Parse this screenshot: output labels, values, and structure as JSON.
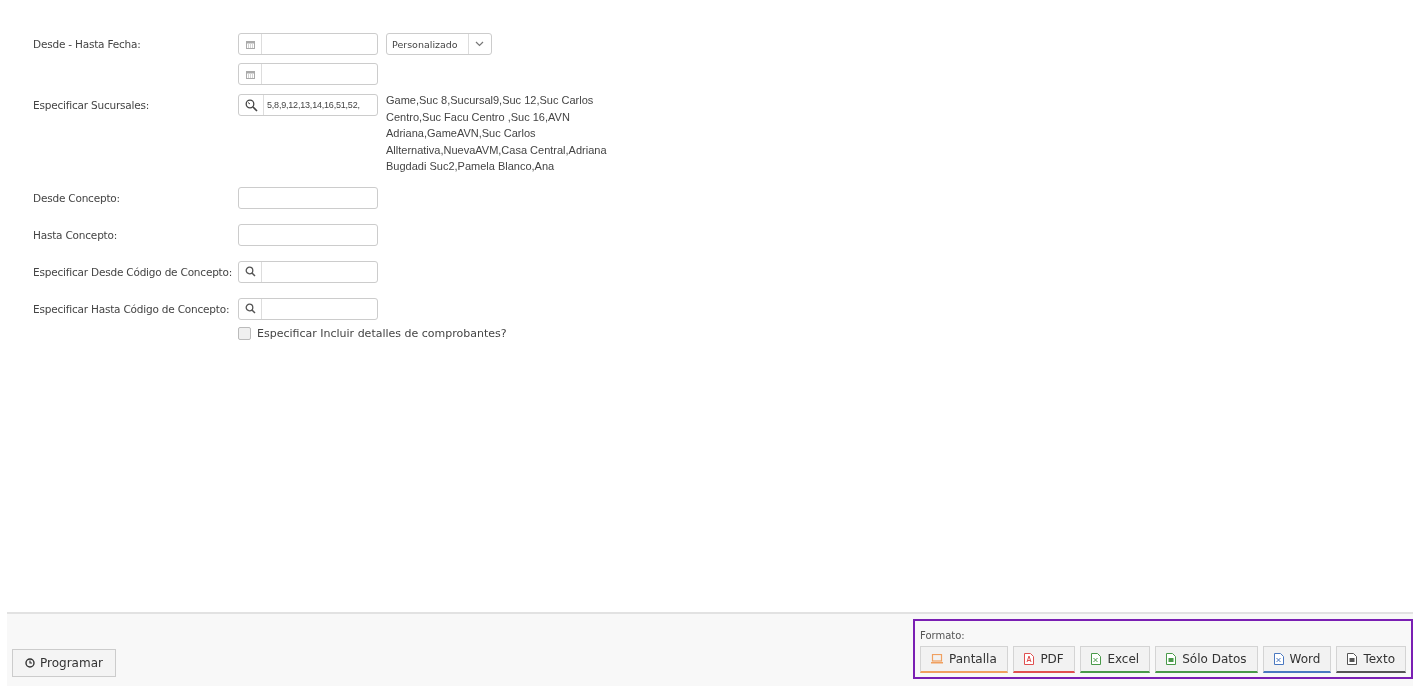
{
  "form": {
    "rows": [
      {
        "kind": "date-range",
        "label": "Desde - Hasta Fecha:",
        "dropdown": "Personalizado"
      },
      {
        "kind": "lookup",
        "label": "Especificar Sucursales:",
        "value": "5,8,9,12,13,14,16,51,52,",
        "description": "Game,Suc 8,Sucursal9,Suc 12,Suc Carlos Centro,Suc Facu Centro ,Suc 16,AVN Adriana,GameAVN,Suc Carlos Allternativa,NuevaAVM,Casa Central,Adriana Bugdadi Suc2,Pamela Blanco,Ana"
      },
      {
        "kind": "text",
        "label": "Desde Concepto:"
      },
      {
        "kind": "text",
        "label": "Hasta Concepto:"
      },
      {
        "kind": "search",
        "label": "Especificar Desde Código de Concepto:"
      },
      {
        "kind": "search",
        "label": "Especificar Hasta Código de Concepto:"
      }
    ],
    "checkbox": {
      "label": "Especificar Incluir detalles de comprobantes?",
      "checked": false
    }
  },
  "footer": {
    "schedule_button": "Programar",
    "format": {
      "label": "Formato:",
      "buttons": [
        {
          "kind": "screen",
          "label": "Pantalla"
        },
        {
          "kind": "pdf",
          "label": "PDF"
        },
        {
          "kind": "excel",
          "label": "Excel"
        },
        {
          "kind": "data",
          "label": "Sólo Datos"
        },
        {
          "kind": "word",
          "label": "Word"
        },
        {
          "kind": "text",
          "label": "Texto"
        }
      ]
    }
  }
}
